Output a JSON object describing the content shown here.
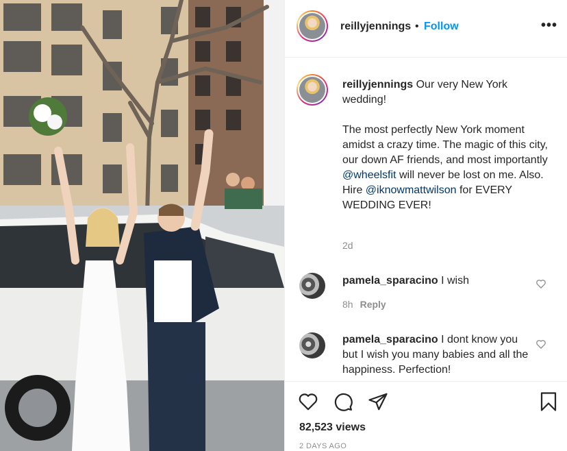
{
  "post": {
    "photo_alt": "Two women celebrating outside a white SUV on a New York street",
    "username": "reillyjennings",
    "separator": "•",
    "follow_label": "Follow",
    "more_label": "•••"
  },
  "caption": {
    "username": "reillyjennings",
    "line1": "Our very New York wedding!",
    "para2_before": "The most perfectly New York moment amidst a crazy time. The magic of this city, our down AF friends, and most importantly",
    "mention1": "@wheelsfit",
    "para2_middle": "will never be lost on me. Also. Hire",
    "mention2": "@iknowmattwilson",
    "para2_after": "for EVERY WEDDING EVER!",
    "age": "2d"
  },
  "comments": [
    {
      "username": "pamela_sparacino",
      "text": "I wish",
      "age": "8h",
      "reply_label": "Reply"
    },
    {
      "username": "pamela_sparacino",
      "text": "I dont know you but I wish you many babies and all the happiness. Perfection!"
    }
  ],
  "footer": {
    "views": "82,523 views",
    "timestamp": "2 DAYS AGO"
  },
  "icons": {
    "like": "heart-icon",
    "comment": "comment-icon",
    "share": "paper-plane-icon",
    "save": "bookmark-icon"
  },
  "colors": {
    "follow_blue": "#0095f6",
    "mention_blue": "#00376b",
    "muted": "#8e8e8e",
    "text": "#262626"
  }
}
